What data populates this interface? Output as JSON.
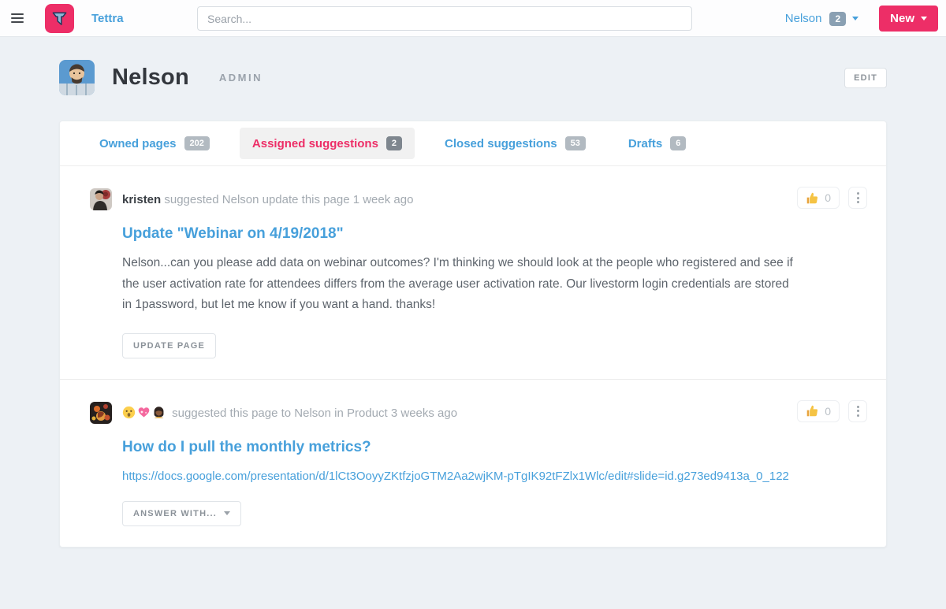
{
  "colors": {
    "brand_pink": "#ED2E67",
    "link_blue": "#47a0db",
    "badge_gray": "#b2bac1",
    "page_bg": "#edf1f5"
  },
  "navbar": {
    "brand": "Tettra",
    "search_placeholder": "Search...",
    "user_name": "Nelson",
    "user_badge": "2",
    "new_button": "New"
  },
  "profile": {
    "name": "Nelson",
    "role": "ADMIN",
    "edit_button": "EDIT"
  },
  "tabs": [
    {
      "label": "Owned pages",
      "count": "202",
      "active": false
    },
    {
      "label": "Assigned suggestions",
      "count": "2",
      "active": true
    },
    {
      "label": "Closed suggestions",
      "count": "53",
      "active": false
    },
    {
      "label": "Drafts",
      "count": "6",
      "active": false
    }
  ],
  "suggestions": [
    {
      "author": "kristen",
      "meta": "suggested Nelson update this page 1 week ago",
      "title": "Update \"Webinar on 4/19/2018\"",
      "body": "Nelson...can you please add data on webinar outcomes? I'm thinking we should look at the people who registered and see if the user activation rate for attendees differs from the average user activation rate. Our livestorm login credentials are stored in 1password, but let me know if you want a hand. thanks!",
      "action_label": "UPDATE PAGE",
      "like_icon": "thumbs-up",
      "like_count": "0"
    },
    {
      "author_emojis": "😯💖👩🏿",
      "meta": "suggested this page to Nelson in Product 3 weeks ago",
      "title": "How do I pull the monthly metrics?",
      "link": "https://docs.google.com/presentation/d/1lCt3OoyyZKtfzjoGTM2Aa2wjKM-pTgIK92tFZlx1Wlc/edit#slide=id.g273ed9413a_0_122",
      "action_label": "ANSWER WITH...",
      "like_icon": "thumbs-up",
      "like_count": "0"
    }
  ]
}
